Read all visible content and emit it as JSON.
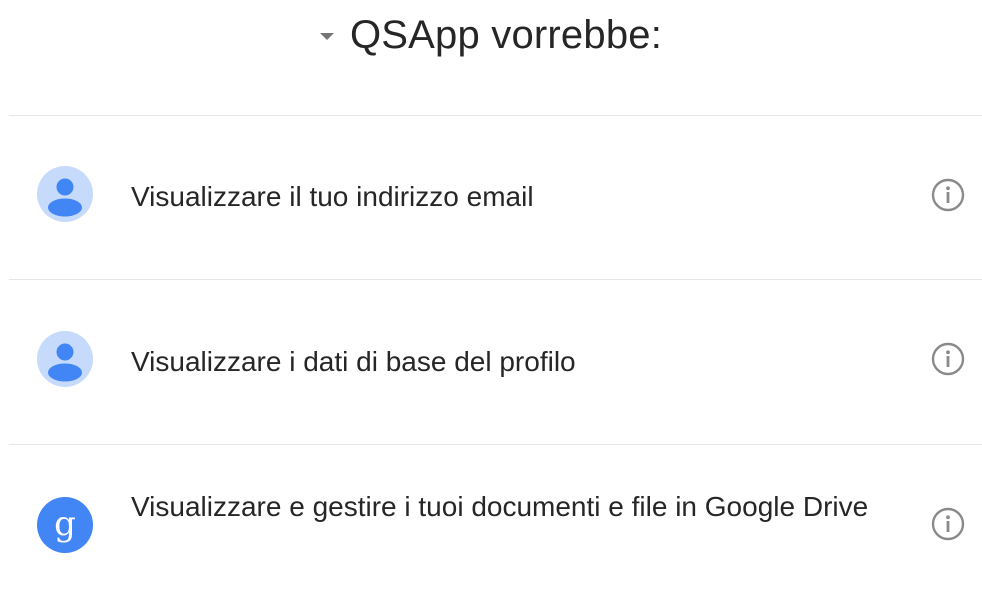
{
  "header": {
    "title": "QSApp vorrebbe:",
    "toggle_icon": "caret-down-icon"
  },
  "colors": {
    "divider": "#e6e6e6",
    "avatar_person_bg": "#c6dafc",
    "avatar_person_fg": "#4285f4",
    "avatar_google_bg": "#4285f4",
    "info_icon": "#8a8a8a"
  },
  "permissions": [
    {
      "label": "Visualizzare il tuo indirizzo email",
      "icon": "person-icon",
      "action_icon": "info-icon"
    },
    {
      "label": "Visualizzare i dati di base del profilo",
      "icon": "person-icon",
      "action_icon": "info-icon"
    },
    {
      "label": "Visualizzare e gestire i tuoi documenti e file in Google Drive",
      "icon": "google-logo-icon",
      "action_icon": "info-icon"
    }
  ]
}
